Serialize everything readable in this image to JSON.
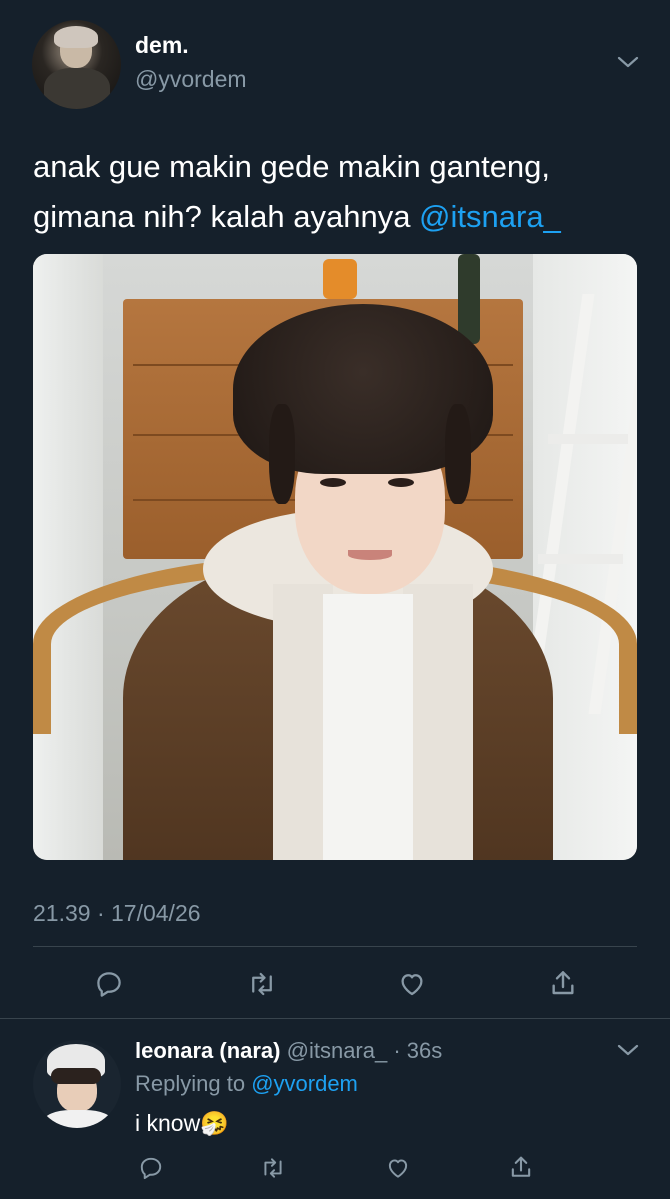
{
  "tweet": {
    "display_name": "dem.",
    "handle": "@yvordem",
    "text_line1": "anak gue makin gede makin ganteng,",
    "text_line2_prefix": "gimana nih? kalah ayahnya ",
    "mention": "@itsnara_",
    "timestamp": "21.39 · 17/04/26"
  },
  "reply": {
    "display_name": "leonara (nara)",
    "handle_time": "@itsnara_ · 36s",
    "replying_prefix": "Replying to ",
    "replying_to": "@yvordem",
    "text": "i know",
    "emoji": "🤧"
  },
  "icons": [
    "reply-icon",
    "retweet-icon",
    "like-icon",
    "share-icon",
    "chevron-down-icon"
  ],
  "colors": {
    "background": "#15202b",
    "muted": "#8899a6",
    "link": "#1da1f2",
    "divider": "#38444d"
  }
}
